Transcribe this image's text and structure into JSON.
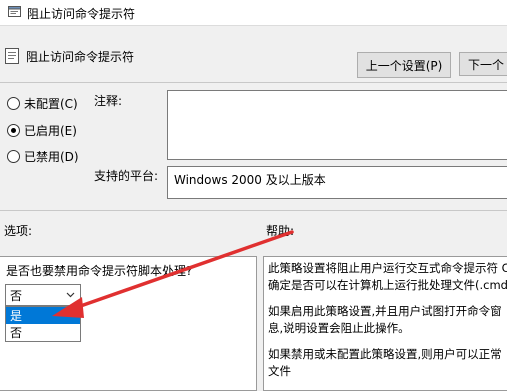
{
  "window": {
    "title": "阻止访问命令提示符"
  },
  "header": {
    "policy_name": "阻止访问命令提示符"
  },
  "nav": {
    "prev_label": "上一个设置(P)",
    "next_label": "下一个"
  },
  "state": {
    "options": [
      {
        "label": "未配置(C)",
        "checked": false
      },
      {
        "label": "已启用(E)",
        "checked": true
      },
      {
        "label": "已禁用(D)",
        "checked": false
      }
    ]
  },
  "comment": {
    "label": "注释:",
    "value": ""
  },
  "platform": {
    "label": "支持的平台:",
    "value": "Windows 2000 及以上版本"
  },
  "options_section": {
    "label": "选项:",
    "question": "是否也要禁用命令提示符脚本处理?",
    "selected": "否",
    "dropdown_items": [
      "是",
      "否"
    ],
    "highlighted_index": 0
  },
  "help_section": {
    "label": "帮助:",
    "lines": [
      "此策略设置将阻止用户运行交互式命令提示符 C",
      "确定是否可以在计算机上运行批处理文件(.cmd",
      "",
      "如果启用此策略设置,并且用户试图打开命令窗",
      "息,说明设置会阻止此操作。",
      "",
      "如果禁用或未配置此策略设置,则用户可以正常",
      "文件"
    ]
  },
  "annotation": {
    "color": "#e03030"
  }
}
